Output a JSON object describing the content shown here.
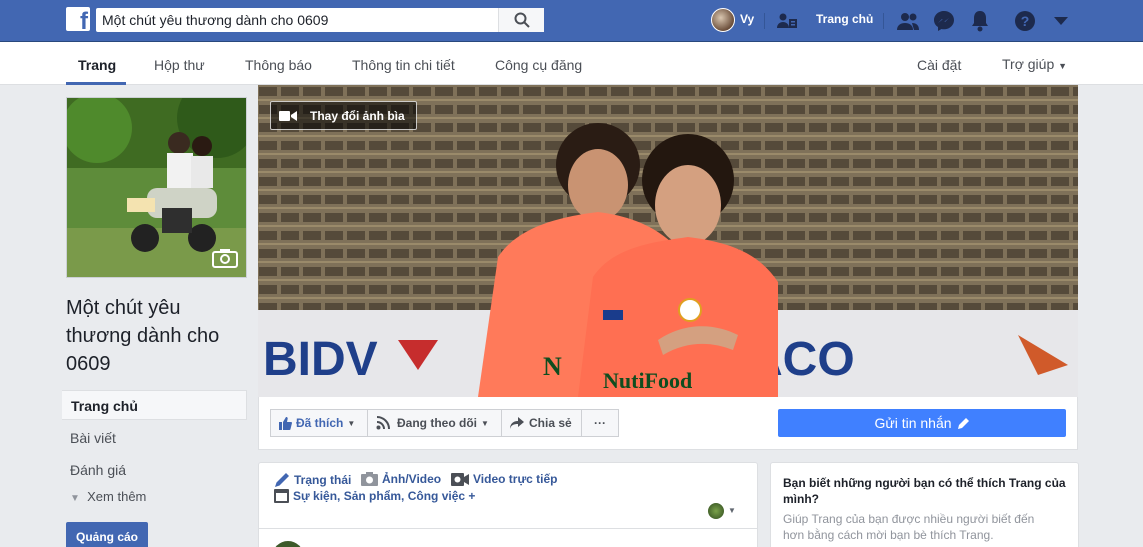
{
  "topbar": {
    "logo_letter": "f",
    "search_value": "Một chút yêu thương dành cho 0609",
    "user_name": "Vy",
    "home_label": "Trang chủ",
    "icons": [
      "search-icon",
      "find-friends-icon",
      "friend-requests-icon",
      "messenger-icon",
      "notifications-icon",
      "help-icon",
      "dropdown-arrow-icon"
    ]
  },
  "pagenav": {
    "tabs": [
      "Trang",
      "Hộp thư",
      "Thông báo",
      "Thông tin chi tiết",
      "Công cụ đăng"
    ],
    "settings": "Cài đặt",
    "help": "Trợ giúp"
  },
  "left": {
    "page_name": "Một chút yêu thương dành cho 0609",
    "menu": [
      "Trang chủ",
      "Bài viết",
      "Đánh giá"
    ],
    "see_more": "Xem thêm",
    "ads_button": "Quảng cáo"
  },
  "cover": {
    "change_cover": "Thay đổi ảnh bìa",
    "sign_bidv": "BIDV",
    "sign_aco": "ACO",
    "shirt_brand": "NutiFood",
    "shirt_brand_partial": "N"
  },
  "actions": {
    "liked": "Đã thích",
    "following": "Đang theo dõi",
    "share": "Chia sẻ",
    "more": "···",
    "send_message": "Gửi tin nhắn"
  },
  "composer": {
    "status": "Trạng thái",
    "photo_video": "Ảnh/Video",
    "live_video": "Video trực tiếp",
    "more_options": "Sự kiện, Sản phẩm, Công việc +"
  },
  "invite": {
    "title": "Bạn biết những người bạn có thể thích Trang của mình?",
    "description": "Giúp Trang của bạn được nhiều người biết đến hơn bằng cách mời bạn bè thích Trang."
  },
  "colors": {
    "brand_blue": "#4267b2",
    "send_button": "#4080ff",
    "link": "#365899"
  }
}
